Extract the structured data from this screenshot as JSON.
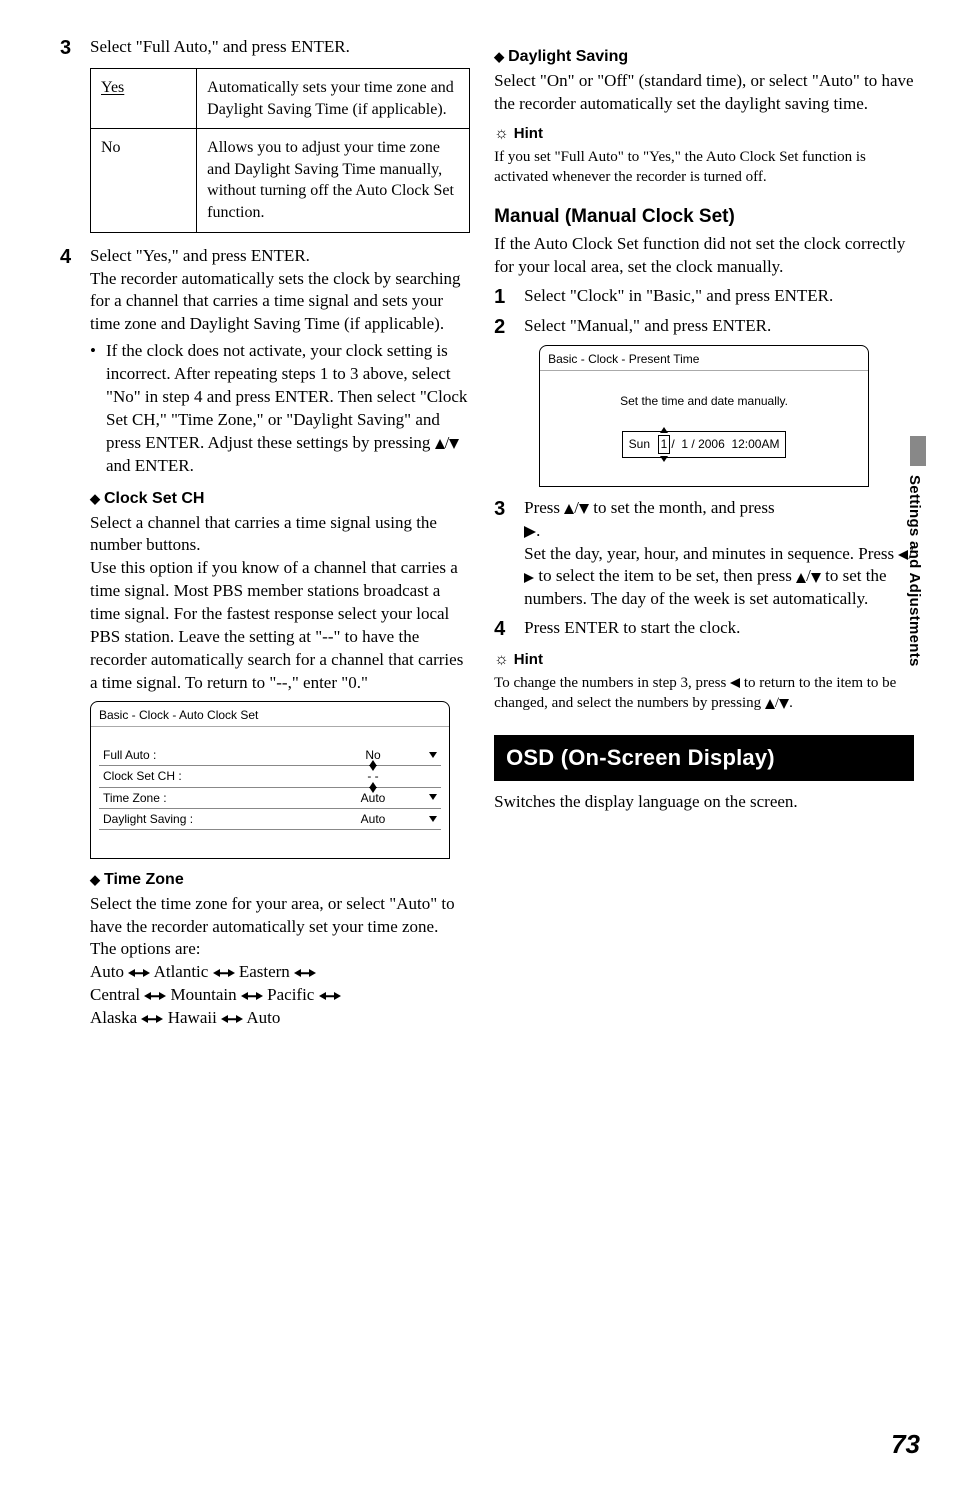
{
  "left": {
    "step3": "Select \"Full Auto,\" and press ENTER.",
    "table": {
      "yes": "Yes",
      "yes_desc": "Automatically sets your time zone and Daylight Saving Time (if applicable).",
      "no": "No",
      "no_desc": "Allows you to adjust your time zone and Daylight Saving Time manually, without turning off the Auto Clock Set function."
    },
    "step4_line1": "Select \"Yes,\" and press ENTER.",
    "step4_rest": "The recorder automatically sets the clock by searching for a channel that carries a time signal and sets your time zone and Daylight Saving Time (if applicable).",
    "step4_bullet": "If the clock does not activate, your clock setting is incorrect. After repeating steps 1 to 3 above, select \"No\" in step 4 and press ENTER. Then select \"Clock Set CH,\" \"Time Zone,\" or \"Daylight Saving\" and press ENTER. Adjust these settings by pressing ",
    "step4_bullet_tail": " and ENTER.",
    "clock_set_ch_h": "Clock Set CH",
    "clock_set_ch_b1": "Select a channel that carries a time signal using the number buttons.",
    "clock_set_ch_b2": "Use this option if you know of a channel that carries a time signal. Most PBS member stations broadcast a time signal. For the fastest response select your local PBS station. Leave the setting at \"--\" to have the recorder automatically search for a channel that carries a time signal. To return to \"--,\" enter \"0.\"",
    "osd1": {
      "title": "Basic - Clock - Auto Clock Set",
      "rows": [
        {
          "label": "Full Auto :",
          "val": "No",
          "arrow": true
        },
        {
          "label": "Clock Set CH :",
          "val": "- -",
          "arrow": false,
          "triUp": true,
          "triDn": true
        },
        {
          "label": "Time Zone :",
          "val": "Auto",
          "arrow": true
        },
        {
          "label": "Daylight Saving :",
          "val": "Auto",
          "arrow": true
        }
      ]
    },
    "time_zone_h": "Time Zone",
    "time_zone_b": "Select the time zone for your area, or select \"Auto\" to have the recorder automatically set your time zone.",
    "time_zone_opt": "The options are:",
    "tz_seq": [
      "Auto",
      "Atlantic",
      "Eastern",
      "Central",
      "Mountain",
      "Pacific",
      "Alaska",
      "Hawaii",
      "Auto"
    ]
  },
  "right": {
    "dls_h": "Daylight Saving",
    "dls_b": "Select \"On\" or \"Off\" (standard time), or select \"Auto\" to have the recorder automatically set the daylight saving time.",
    "hint1_h": "Hint",
    "hint1_b": "If you set \"Full Auto\" to \"Yes,\" the Auto Clock Set function is activated whenever the recorder is turned off.",
    "manual_h": "Manual (Manual Clock Set)",
    "manual_intro": "If the Auto Clock Set function did not set the clock correctly for your local area, set the clock manually.",
    "mstep1": "Select \"Clock\" in \"Basic,\" and press ENTER.",
    "mstep2": "Select \"Manual,\" and press ENTER.",
    "osd2": {
      "title": "Basic - Clock - Present Time",
      "msg": "Set the time and date manually.",
      "fields": {
        "dow": "Sun",
        "m": "1",
        "d": "1",
        "y": "2006",
        "t": "12:00AM"
      }
    },
    "mstep3_a": "Press ",
    "mstep3_b": " to set the month, and press ",
    "mstep3_c": ".",
    "mstep3_p2a": "Set the day, year, hour, and minutes in sequence. Press ",
    "mstep3_p2b": " to select the item to be set, then press ",
    "mstep3_p2c": " to set the numbers. The day of the week is set automatically.",
    "mstep4": "Press ENTER to start the clock.",
    "hint2_h": "Hint",
    "hint2_b_a": "To change the numbers in step 3, press ",
    "hint2_b_b": " to return to the item to be changed, and select the numbers by pressing ",
    "hint2_b_c": ".",
    "osd_heading": "OSD (On-Screen Display)",
    "osd_after": "Switches the display language on the screen."
  },
  "side": "Settings and Adjustments",
  "page_num": "73",
  "num3": "3",
  "num4": "4",
  "num1": "1",
  "num2": "2"
}
